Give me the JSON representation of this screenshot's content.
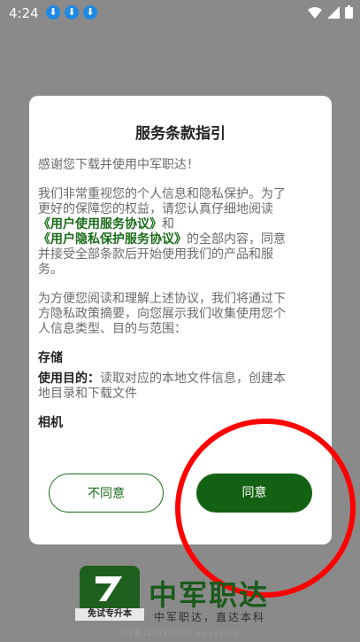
{
  "status": {
    "time": "4:24",
    "download_icon": "download-icon"
  },
  "dialog": {
    "title": "服务条款指引",
    "para1": "感谢您下载并使用中军职达！",
    "para2_part1": "我们非常重视您的个人信息和隐私保护。为了更好的保障您的权益，请您认真仔细地阅读",
    "link_user_agreement": "《用户使用服务协议》",
    "para2_and": "和",
    "link_privacy": "《用户隐私保护服务协议》",
    "para2_part2": "的全部内容，同意并接受全部条款后开始使用我们的产品和服务。",
    "para3": "为方便您阅读和理解上述协议，我们将通过下方隐私政策摘要，向您展示我们收集使用您个人信息类型、目的与范围：",
    "storage_title": "存储",
    "purpose_label": "使用目的：",
    "purpose_text": "读取对应的本地文件信息，创建本地目录和下载文件",
    "camera_title": "相机",
    "disagree_label": "不同意",
    "agree_label": "同意"
  },
  "brand": {
    "badge_text": "免试专升本",
    "name": "中军职达",
    "slogan": "中军职达，直达本科",
    "footer": "ICP备1404393 0号-6A | v1.0.0"
  },
  "colors": {
    "primary": "#136213",
    "link": "#1a6b1a",
    "annotation": "#ff0000"
  }
}
